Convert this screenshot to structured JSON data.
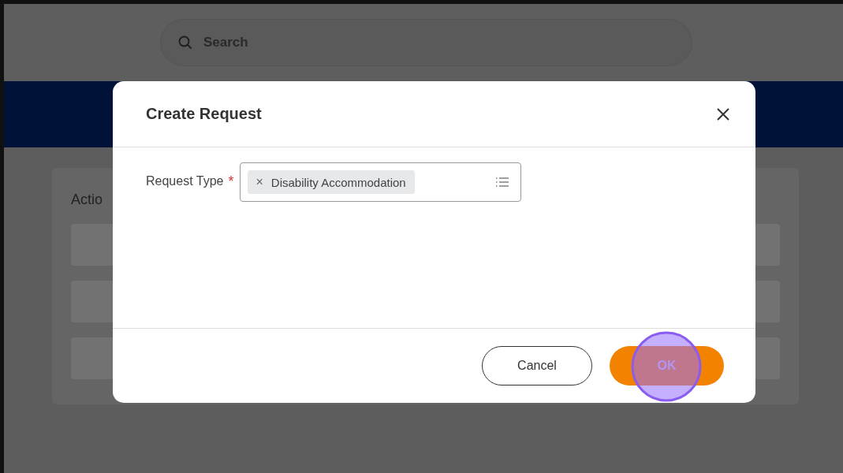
{
  "search": {
    "placeholder": "Search"
  },
  "background_card": {
    "heading": "Actio"
  },
  "dialog": {
    "title": "Create Request",
    "field": {
      "label": "Request Type",
      "required_mark": "*",
      "chips": [
        {
          "remove": "×",
          "label": "Disability Accommodation"
        }
      ]
    },
    "buttons": [
      {
        "label": "Cancel",
        "kind": "secondary"
      },
      {
        "label": "OK",
        "kind": "primary"
      }
    ]
  }
}
